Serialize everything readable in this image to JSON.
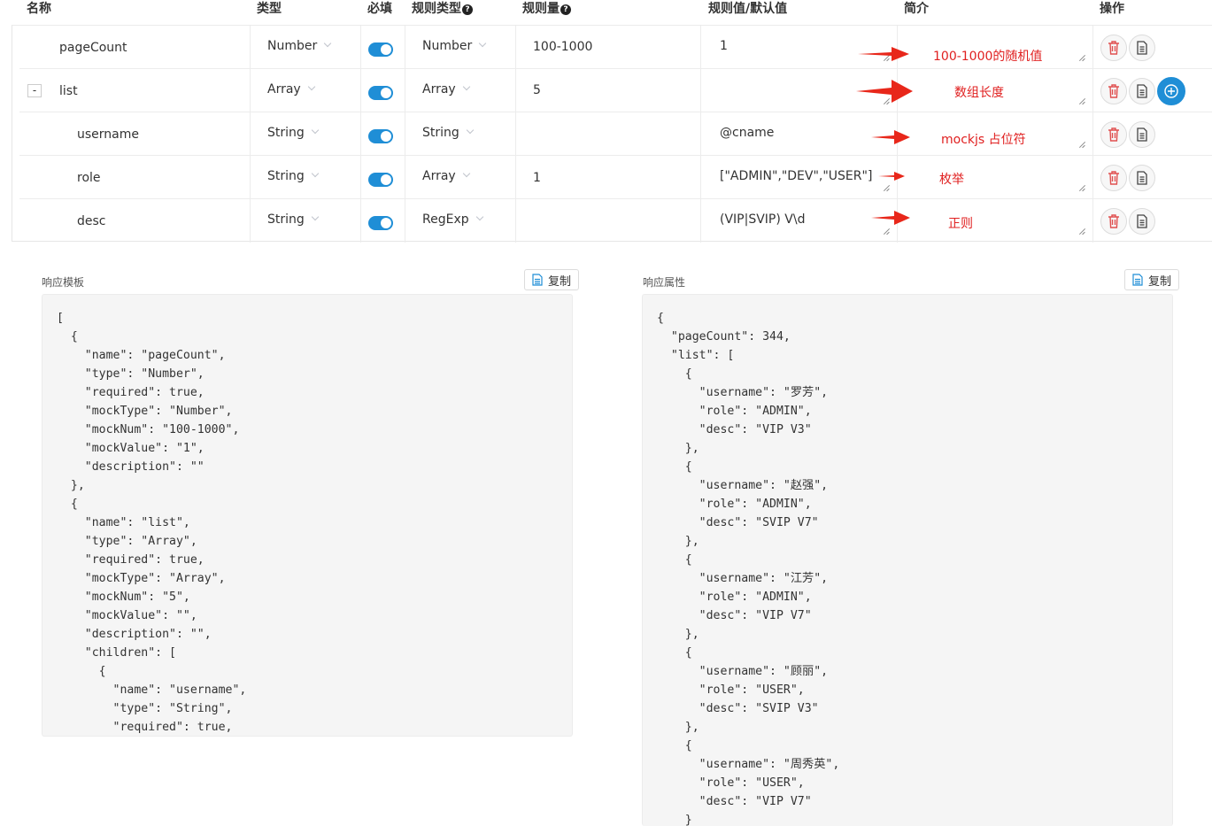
{
  "table": {
    "headers": {
      "name": "名称",
      "type": "类型",
      "required": "必填",
      "mock_type": "规则类型",
      "mock_num": "规则量",
      "mock_value": "规则值/默认值",
      "description": "简介",
      "actions": "操作"
    },
    "help_icon": "question-circle-icon",
    "rows": [
      {
        "name": "pageCount",
        "type": "Number",
        "required": true,
        "mock_type": "Number",
        "mock_num": "100-1000",
        "mock_value": "1",
        "description": "100-1000的随机值",
        "expandable": false
      },
      {
        "name": "list",
        "type": "Array",
        "required": true,
        "mock_type": "Array",
        "mock_num": "5",
        "mock_value": "",
        "description": "数组长度",
        "expandable": true,
        "collapse_label": "-"
      },
      {
        "name": "username",
        "type": "String",
        "required": true,
        "mock_type": "String",
        "mock_num": "",
        "mock_value": "@cname",
        "description": "mockjs 占位符",
        "expandable": false
      },
      {
        "name": "role",
        "type": "String",
        "required": true,
        "mock_type": "Array",
        "mock_num": "1",
        "mock_value": "[\"ADMIN\",\"DEV\",\"USER\"]",
        "description": "枚举",
        "expandable": false
      },
      {
        "name": "desc",
        "type": "String",
        "required": true,
        "mock_type": "RegExp",
        "mock_num": "",
        "mock_value": "(VIP|SVIP) V\\d",
        "description": "正则",
        "expandable": false
      }
    ],
    "action_icons": [
      "trash-icon",
      "copy-icon",
      "plus-circle-icon"
    ],
    "colors": {
      "switch_on": "#1f8ed6",
      "annotation": "#e02020",
      "delete_icon": "#e05050",
      "add_button": "#1f8ed6"
    }
  },
  "template_panel": {
    "label": "响应模板",
    "copy_label": "复制",
    "code": "[\n  {\n    \"name\": \"pageCount\",\n    \"type\": \"Number\",\n    \"required\": true,\n    \"mockType\": \"Number\",\n    \"mockNum\": \"100-1000\",\n    \"mockValue\": \"1\",\n    \"description\": \"\"\n  },\n  {\n    \"name\": \"list\",\n    \"type\": \"Array\",\n    \"required\": true,\n    \"mockType\": \"Array\",\n    \"mockNum\": \"5\",\n    \"mockValue\": \"\",\n    \"description\": \"\",\n    \"children\": [\n      {\n        \"name\": \"username\",\n        \"type\": \"String\",\n        \"required\": true,"
  },
  "response_panel": {
    "label": "响应属性",
    "copy_label": "复制",
    "code": "{\n  \"pageCount\": 344,\n  \"list\": [\n    {\n      \"username\": \"罗芳\",\n      \"role\": \"ADMIN\",\n      \"desc\": \"VIP V3\"\n    },\n    {\n      \"username\": \"赵强\",\n      \"role\": \"ADMIN\",\n      \"desc\": \"SVIP V7\"\n    },\n    {\n      \"username\": \"江芳\",\n      \"role\": \"ADMIN\",\n      \"desc\": \"VIP V7\"\n    },\n    {\n      \"username\": \"顾丽\",\n      \"role\": \"USER\",\n      \"desc\": \"SVIP V3\"\n    },\n    {\n      \"username\": \"周秀英\",\n      \"role\": \"USER\",\n      \"desc\": \"VIP V7\"\n    }"
  }
}
